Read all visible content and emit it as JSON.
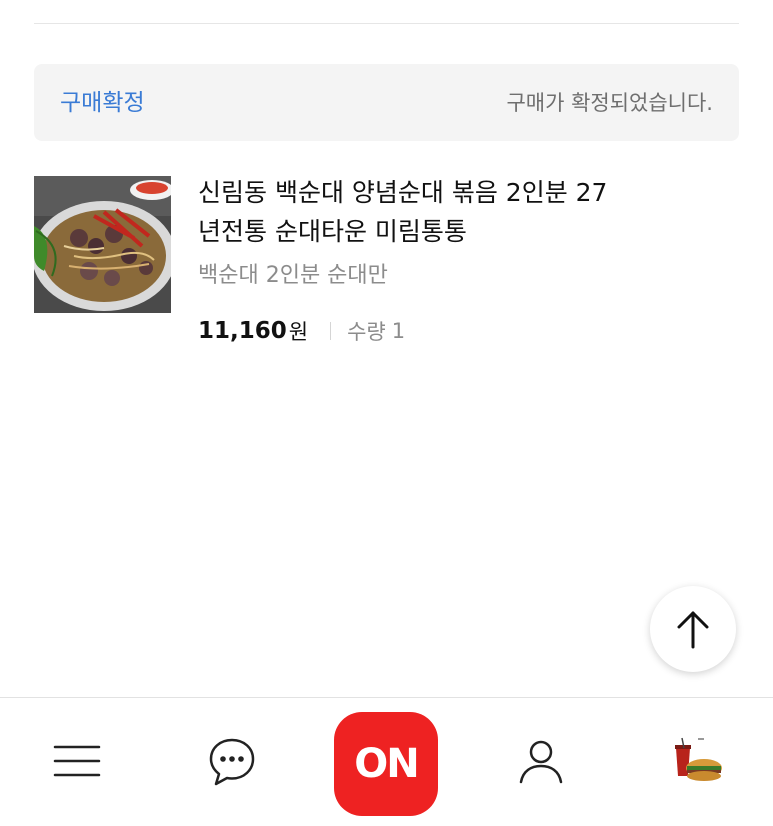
{
  "order_status": {
    "label": "구매확정",
    "message": "구매가 확정되었습니다."
  },
  "product": {
    "title_line1": "신림동 백순대 양념순대 볶음 2인분 27",
    "title_line2": "년전통 순대타운 미림통통",
    "option": "백순대 2인분 순대만",
    "price": "11,160",
    "price_unit": "원",
    "quantity_label": "수량",
    "quantity": "1",
    "image": "stir-fried-sundae-dish"
  },
  "scroll_top": {
    "icon": "arrow-up-icon"
  },
  "bottom_nav": {
    "items": [
      {
        "icon": "menu-icon"
      },
      {
        "icon": "chat-icon"
      },
      {
        "label": "ON"
      },
      {
        "icon": "person-icon"
      },
      {
        "icon": "recent-product-thumbnail"
      }
    ]
  },
  "colors": {
    "accent_blue": "#3a7bd5",
    "on_red": "#ee2222",
    "banner_bg": "#f4f4f4"
  }
}
